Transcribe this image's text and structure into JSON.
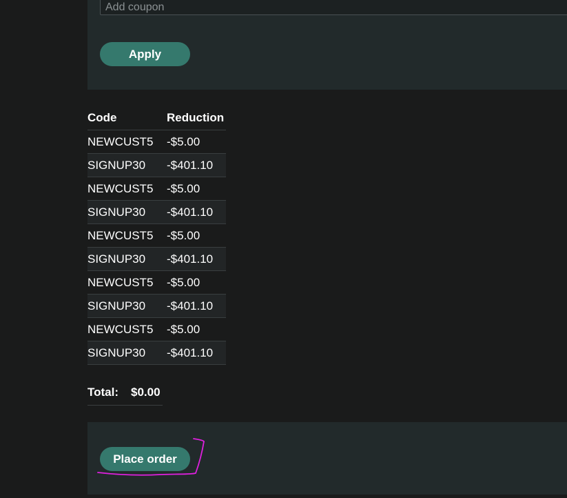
{
  "coupon": {
    "placeholder": "Add coupon",
    "apply_label": "Apply"
  },
  "table": {
    "headers": {
      "code": "Code",
      "reduction": "Reduction"
    },
    "rows": [
      {
        "code": "NEWCUST5",
        "reduction": "-$5.00"
      },
      {
        "code": "SIGNUP30",
        "reduction": "-$401.10"
      },
      {
        "code": "NEWCUST5",
        "reduction": "-$5.00"
      },
      {
        "code": "SIGNUP30",
        "reduction": "-$401.10"
      },
      {
        "code": "NEWCUST5",
        "reduction": "-$5.00"
      },
      {
        "code": "SIGNUP30",
        "reduction": "-$401.10"
      },
      {
        "code": "NEWCUST5",
        "reduction": "-$5.00"
      },
      {
        "code": "SIGNUP30",
        "reduction": "-$401.10"
      },
      {
        "code": "NEWCUST5",
        "reduction": "-$5.00"
      },
      {
        "code": "SIGNUP30",
        "reduction": "-$401.10"
      }
    ]
  },
  "total": {
    "label": "Total:",
    "value": "$0.00"
  },
  "order": {
    "place_order_label": "Place order"
  },
  "colors": {
    "background": "#1a1b1b",
    "panel": "#222a2b",
    "button": "#35796d",
    "annotation": "#e020e0"
  }
}
